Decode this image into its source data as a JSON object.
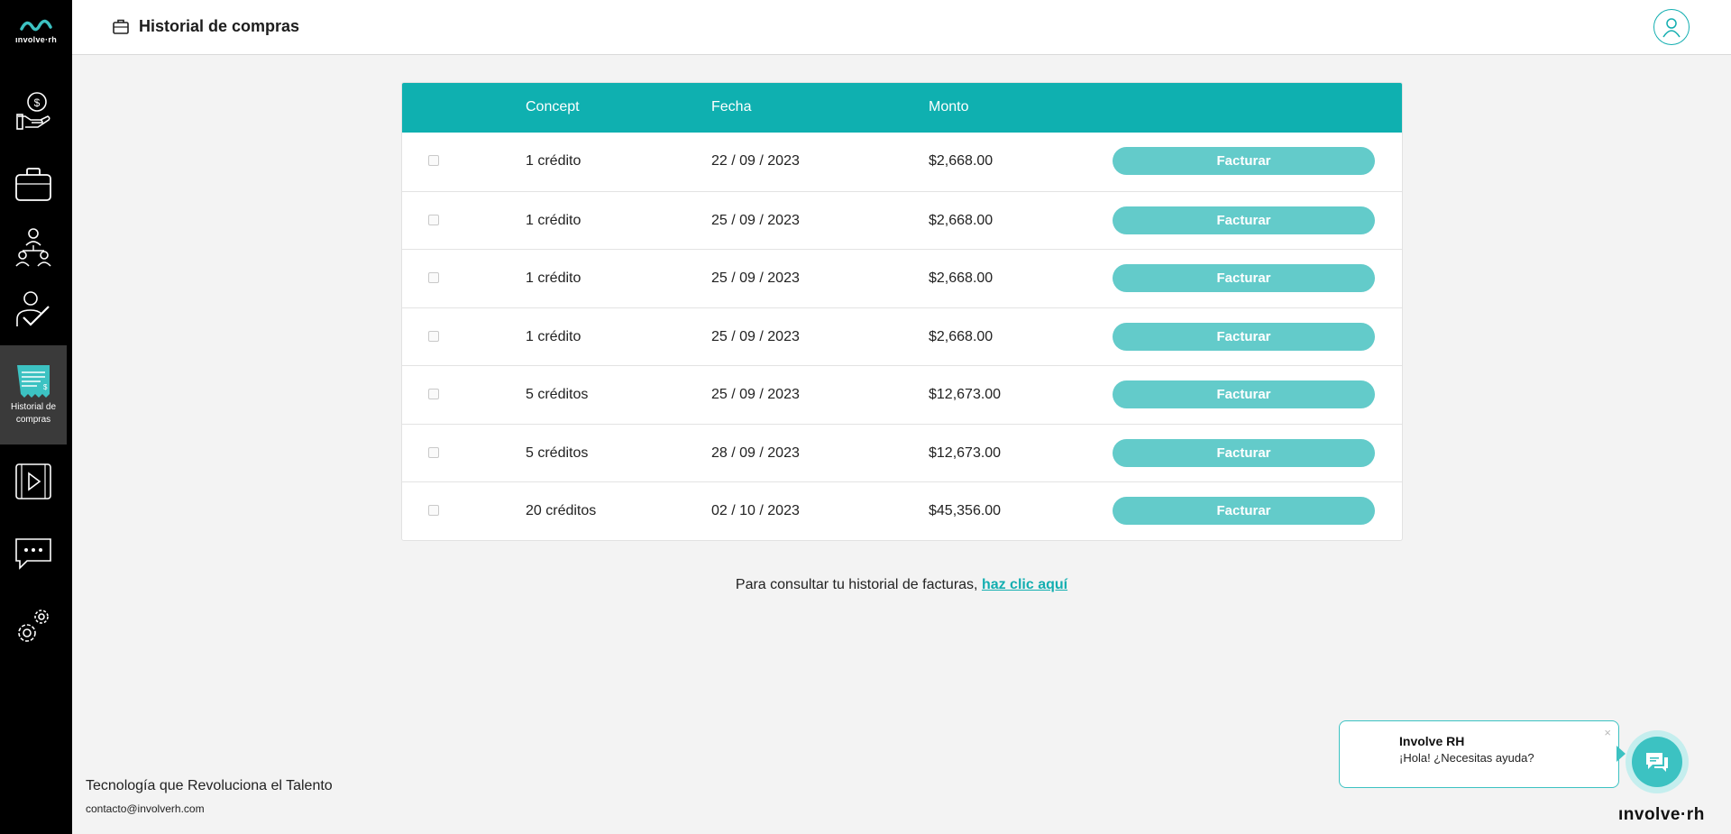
{
  "app": {
    "logo_text": "ınvolve·rh",
    "page_title": "Historial de compras"
  },
  "sidebar": {
    "items": [
      {
        "icon": "hand-money-icon",
        "label": ""
      },
      {
        "icon": "briefcase-icon",
        "label": ""
      },
      {
        "icon": "team-network-icon",
        "label": ""
      },
      {
        "icon": "person-check-icon",
        "label": ""
      },
      {
        "icon": "receipt-icon",
        "label": "Historial de compras",
        "active": true
      },
      {
        "icon": "video-icon",
        "label": ""
      },
      {
        "icon": "chat-icon",
        "label": ""
      },
      {
        "icon": "settings-icon",
        "label": ""
      }
    ]
  },
  "table": {
    "headers": {
      "concept": "Concept",
      "date": "Fecha",
      "amount": "Monto"
    },
    "rows": [
      {
        "concept": "1 crédito",
        "date": "22 / 09 / 2023",
        "amount": "$2,668.00",
        "action": "Facturar"
      },
      {
        "concept": "1 crédito",
        "date": "25 / 09 / 2023",
        "amount": "$2,668.00",
        "action": "Facturar"
      },
      {
        "concept": "1 crédito",
        "date": "25 / 09 / 2023",
        "amount": "$2,668.00",
        "action": "Facturar"
      },
      {
        "concept": "1 crédito",
        "date": "25 / 09 / 2023",
        "amount": "$2,668.00",
        "action": "Facturar"
      },
      {
        "concept": "5 créditos",
        "date": "25 / 09 / 2023",
        "amount": "$12,673.00",
        "action": "Facturar"
      },
      {
        "concept": "5 créditos",
        "date": "28 / 09 / 2023",
        "amount": "$12,673.00",
        "action": "Facturar"
      },
      {
        "concept": "20 créditos",
        "date": "02 / 10 / 2023",
        "amount": "$45,356.00",
        "action": "Facturar"
      }
    ]
  },
  "invoice_history": {
    "text": "Para consultar tu historial de facturas,",
    "link": "haz clic aquí"
  },
  "footer": {
    "tagline": "Tecnología que Revoluciona el Talento",
    "email": "contacto@involverh.com"
  },
  "chat": {
    "name": "Involve RH",
    "message": "¡Hola! ¿Necesitas ayuda?",
    "close": "×",
    "brand": "ınvolve·rh"
  },
  "colors": {
    "accent": "#0fb0b0",
    "button": "#63cbca",
    "sidebar": "#000000"
  }
}
